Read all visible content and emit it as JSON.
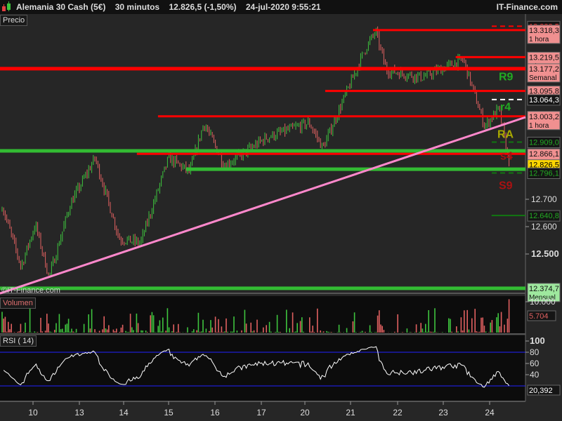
{
  "header": {
    "instrument": "Alemania 30 Cash (5€)",
    "timeframe": "30 minutos",
    "price": "12.826,5 (-1,50%)",
    "datetime": "24-jul-2020 9:55:21",
    "site": "IT-Finance.com"
  },
  "panels": {
    "price": "Precio",
    "volume": "Volumen",
    "rsi": "RSI ( 14)",
    "watermark": "©IT-Finance.com"
  },
  "colors": {
    "up": "#3ec43e",
    "down": "#e06060",
    "trendline": "#ff88cc",
    "resistance": "#ff0000",
    "support": "#33bb33",
    "rsi_line": "#ffffff",
    "rsi_bands": "#2222ff"
  },
  "chart_data": [
    {
      "type": "candlestick",
      "title": "Precio",
      "x_ticks": [
        "10",
        "13",
        "14",
        "15",
        "16",
        "17",
        "20",
        "21",
        "22",
        "23",
        "24"
      ],
      "y_ticks": [
        "12.500",
        "12.600",
        "12.700"
      ],
      "ylim": [
        12350,
        13350
      ],
      "price_path_sessions_since_10": [
        [
          -0.64,
          12659
        ],
        [
          -0.26,
          12454
        ],
        [
          0.05,
          12608
        ],
        [
          0.35,
          12415
        ],
        [
          0.81,
          12682
        ],
        [
          1.35,
          12851
        ],
        [
          1.88,
          12556
        ],
        [
          2.34,
          12541
        ],
        [
          2.95,
          12851
        ],
        [
          3.41,
          12800
        ],
        [
          3.72,
          12979
        ],
        [
          4.17,
          12823
        ],
        [
          5.09,
          12926
        ],
        [
          6.01,
          12979
        ],
        [
          6.31,
          12887
        ],
        [
          6.77,
          13069
        ],
        [
          7.23,
          13249
        ],
        [
          7.46,
          13313
        ],
        [
          7.69,
          13172
        ],
        [
          8.46,
          13146
        ],
        [
          9.37,
          13210
        ],
        [
          9.83,
          12967
        ],
        [
          10.14,
          13031
        ],
        [
          10.37,
          12826
        ]
      ],
      "last": "12.826,5",
      "trendline": [
        [
          -0.72,
          12356
        ],
        [
          10.72,
          13000
        ]
      ],
      "levels": [
        {
          "price": 13332.5,
          "label": "13.332,5",
          "style": "dashed",
          "color": "#ff0000",
          "box": "dark"
        },
        {
          "price": 13318.3,
          "label": "13.318,3",
          "sub": "1 hora",
          "style": "solid",
          "color": "#ff0000",
          "box": "red",
          "from": 7.4
        },
        {
          "price": 13219.5,
          "label": "13.219,5",
          "sub": "1 hora",
          "style": "solid",
          "color": "#ff0000",
          "box": "red",
          "from": 9.2
        },
        {
          "price": 13177.2,
          "label": "13.177,2",
          "sub": "Semanal",
          "style": "thick",
          "color": "#ff0000",
          "box": "red",
          "from": -0.72
        },
        {
          "price": 13095.8,
          "label": "13.095,8",
          "sub": "1 hora",
          "style": "solid",
          "color": "#ff0000",
          "box": "red",
          "from": 6.36
        },
        {
          "price": 13064.3,
          "label": "13.064,3",
          "style": "dashed",
          "color": "#ffffff",
          "box": "dark"
        },
        {
          "price": 13003.2,
          "label": "13.003,2",
          "sub": "1 hora",
          "style": "solid",
          "color": "#ff0000",
          "box": "red",
          "from": 2.72
        },
        {
          "price": 12909.0,
          "label": "12.909,0",
          "style": "dashed",
          "color": "#117711",
          "box": "dkgreen"
        },
        {
          "price": 12877,
          "label": "",
          "style": "thick",
          "color": "#33bb33",
          "box": "none",
          "from": -0.72
        },
        {
          "price": 12866.1,
          "label": "12.866,1",
          "sub": "1 hora",
          "style": "solid",
          "color": "#ff0000",
          "box": "red",
          "from": 2.26
        },
        {
          "price": 12826.5,
          "label": "12.826,5",
          "style": "none",
          "color": "#ffcc00",
          "box": "yellow"
        },
        {
          "price": 12810,
          "label": "",
          "style": "thick",
          "color": "#33bb33",
          "box": "none",
          "from": 3.33
        },
        {
          "price": 12796.1,
          "label": "12.796,1",
          "style": "dashed",
          "color": "#117711",
          "box": "dkgreen"
        },
        {
          "price": 12640.8,
          "label": "12.640,8",
          "style": "solid",
          "color": "#117711",
          "box": "dkgreen",
          "from": 9.98
        },
        {
          "price": 12374.7,
          "label": "12.374,7",
          "sub": "Mensual",
          "style": "thick",
          "color": "#33bb33",
          "box": "green",
          "from": -0.72
        }
      ],
      "pivot_labels": [
        {
          "text": "R9",
          "price": 13150,
          "color": "#22aa22"
        },
        {
          "text": "r4",
          "price": 13040,
          "color": "#22aa22"
        },
        {
          "text": "RA",
          "price": 12940,
          "color": "#aaaa00"
        },
        {
          "text": "s4",
          "price": 12860,
          "color": "#aa1111"
        },
        {
          "text": "S9",
          "price": 12752,
          "color": "#aa1111"
        }
      ]
    },
    {
      "type": "bar",
      "title": "Volumen",
      "y_ticks": [
        "10.000"
      ],
      "last": "5.704",
      "ylim": [
        0,
        11000
      ]
    },
    {
      "type": "line",
      "title": "RSI ( 14)",
      "y_ticks": [
        "100",
        "80",
        "60",
        "40"
      ],
      "bands": [
        20,
        80
      ],
      "last": "20,392",
      "ylim": [
        0,
        100
      ]
    }
  ]
}
